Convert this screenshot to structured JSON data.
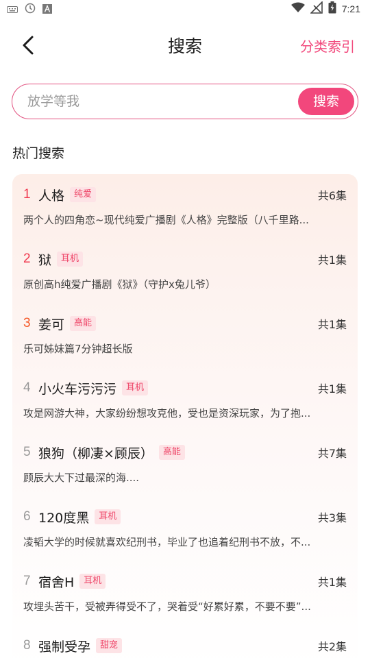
{
  "status_bar": {
    "time": "7:21"
  },
  "header": {
    "title": "搜索",
    "category_index": "分类索引"
  },
  "search": {
    "placeholder": "放学等我",
    "button_label": "搜索"
  },
  "section_title": "热门搜索",
  "colors": {
    "accent": "#f2477c",
    "rank_top": "#f0394f",
    "rank_third": "#f55a2a",
    "tag_bg": "#fde3e6"
  },
  "hot_items": [
    {
      "rank": "1",
      "title": "人格",
      "tag": "纯爱",
      "episodes": "共6集",
      "desc": "两个人的四角恋~现代纯爱广播剧《人格》完整版（八千里路..."
    },
    {
      "rank": "2",
      "title": "狱",
      "tag": "耳机",
      "episodes": "共1集",
      "desc": "原创高h纯爱广播剧《狱》（守护x兔儿爷）"
    },
    {
      "rank": "3",
      "title": "姜可",
      "tag": "高能",
      "episodes": "共1集",
      "desc": "乐可姊妹篇7分钟超长版"
    },
    {
      "rank": "4",
      "title": "小火车污污污",
      "tag": "耳机",
      "episodes": "共1集",
      "desc": "攻是网游大神，大家纷纷想攻克他，受也是资深玩家，为了抱..."
    },
    {
      "rank": "5",
      "title": "狼狗（柳凄×顾辰）",
      "tag": "高能",
      "episodes": "共7集",
      "desc": "顾辰大大下过最深的海...."
    },
    {
      "rank": "6",
      "title": "120度黑",
      "tag": "耳机",
      "episodes": "共3集",
      "desc": "凌韬大学的时候就喜欢纪刑书，毕业了也追着纪刑书不放，不..."
    },
    {
      "rank": "7",
      "title": "宿舍H",
      "tag": "耳机",
      "episodes": "共1集",
      "desc": "攻埋头苦干，受被弄得受不了，哭着受“好累好累，不要不要”..."
    },
    {
      "rank": "8",
      "title": "强制受孕",
      "tag": "甜宠",
      "episodes": "共2集",
      "desc": ""
    }
  ]
}
